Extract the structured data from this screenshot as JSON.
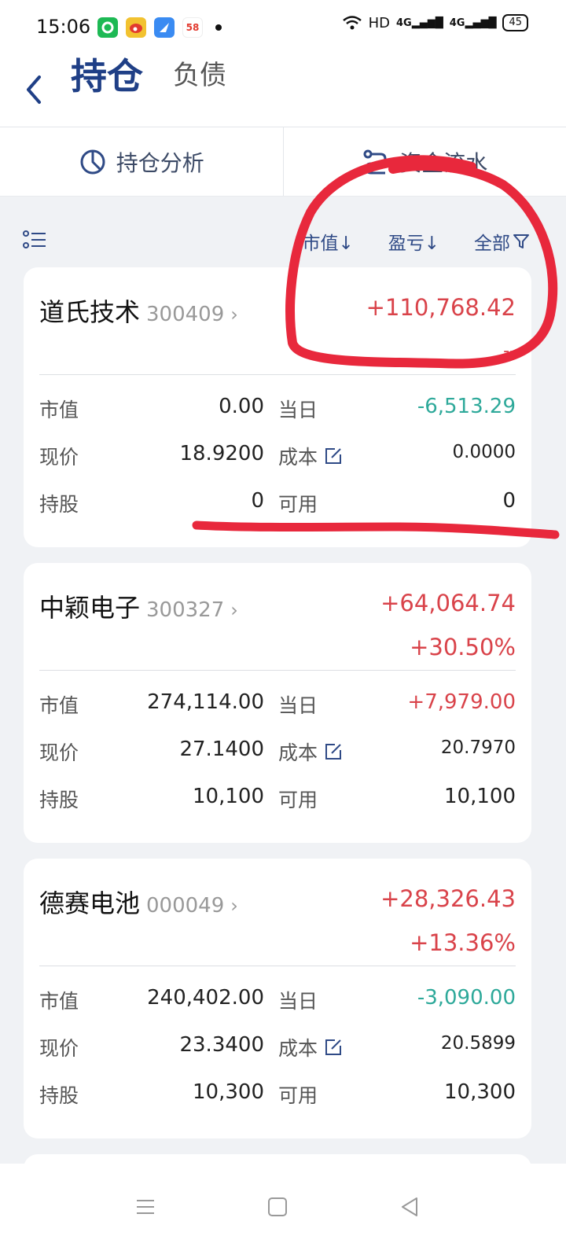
{
  "status": {
    "time": "15:06",
    "app_badge_58": "58",
    "network_label": "HD",
    "signal_1": "4G",
    "signal_2": "4G",
    "battery": "45"
  },
  "header": {
    "active_tab": "持仓",
    "inactive_tab": "负债"
  },
  "tools": {
    "analysis": "持仓分析",
    "flow": "资金流水"
  },
  "sort": {
    "market_value": "市值↓",
    "pnl": "盈亏↓",
    "filter": "全部"
  },
  "labels": {
    "market_value": "市值",
    "today": "当日",
    "price": "现价",
    "cost": "成本",
    "shares": "持股",
    "available": "可用"
  },
  "stocks": [
    {
      "name": "道氏技术",
      "code": "300409",
      "pnl": "+110,768.42",
      "pnl_pct": "--",
      "market_value": "0.00",
      "today": "-6,513.29",
      "price": "18.9200",
      "cost": "0.0000",
      "shares": "0",
      "available": "0"
    },
    {
      "name": "中颖电子",
      "code": "300327",
      "pnl": "+64,064.74",
      "pnl_pct": "+30.50%",
      "market_value": "274,114.00",
      "today": "+7,979.00",
      "price": "27.1400",
      "cost": "20.7970",
      "shares": "10,100",
      "available": "10,100"
    },
    {
      "name": "德赛电池",
      "code": "000049",
      "pnl": "+28,326.43",
      "pnl_pct": "+13.36%",
      "market_value": "240,402.00",
      "today": "-3,090.00",
      "price": "23.3400",
      "cost": "20.5899",
      "shares": "10,300",
      "available": "10,300"
    }
  ],
  "colors": {
    "brand": "#1f3f86",
    "profit": "#d9434a",
    "loss": "#2ea99a",
    "annotation": "#e8283c"
  }
}
